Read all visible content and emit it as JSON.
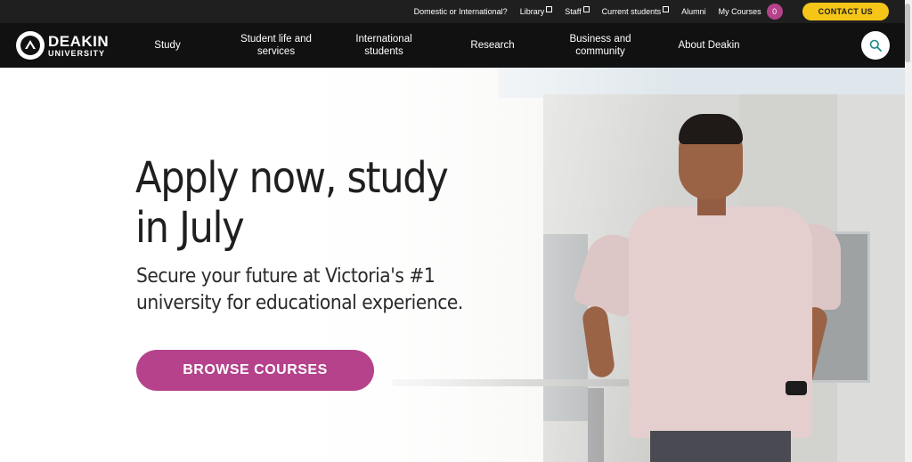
{
  "utility_bar": {
    "links": [
      {
        "label": "Domestic or International?",
        "external": false
      },
      {
        "label": "Library",
        "external": true
      },
      {
        "label": "Staff",
        "external": true
      },
      {
        "label": "Current students",
        "external": true
      },
      {
        "label": "Alumni",
        "external": false
      },
      {
        "label": "My Courses",
        "external": false
      }
    ],
    "my_courses_count": "0",
    "contact_label": "CONTACT US",
    "colors": {
      "background": "#1f1f1f",
      "contact": "#f5c518",
      "badge": "#b5428b"
    }
  },
  "logo": {
    "line1": "DEAKIN",
    "line2": "UNIVERSITY"
  },
  "nav": {
    "items": [
      {
        "label": "Study"
      },
      {
        "label": "Student life and services"
      },
      {
        "label": "International students"
      },
      {
        "label": "Research"
      },
      {
        "label": "Business and community"
      },
      {
        "label": "About Deakin"
      }
    ],
    "search_icon": "search-icon"
  },
  "hero": {
    "headline": "Apply now, study in July",
    "subline": "Secure your future at Victoria's #1 university for educational experience.",
    "button_label": "BROWSE COURSES",
    "button_color": "#b5428b"
  }
}
